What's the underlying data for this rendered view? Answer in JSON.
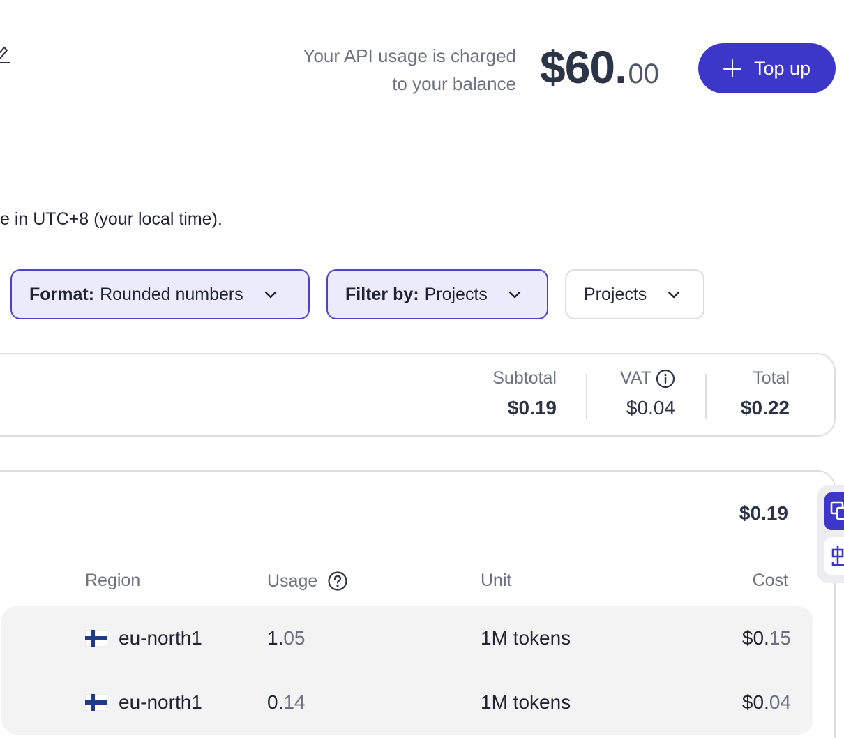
{
  "header": {
    "balance_caption_line1": "Your API usage is charged",
    "balance_caption_line2": "to your balance",
    "balance_main": "$60.",
    "balance_cents": "00",
    "topup_label": "Top up"
  },
  "timezone_note": "e in UTC+8 (your local time).",
  "filters": {
    "format_key": "Format:",
    "format_value": "Rounded numbers",
    "filter_key": "Filter by:",
    "filter_value": "Projects",
    "projects_label": "Projects"
  },
  "summary": {
    "subtotal_label": "Subtotal",
    "subtotal_value": "$0.19",
    "vat_label": "VAT",
    "vat_value": "$0.04",
    "total_label": "Total",
    "total_value": "$0.22"
  },
  "project": {
    "total": "$0.19"
  },
  "table": {
    "headers": {
      "region": "Region",
      "usage": "Usage",
      "unit": "Unit",
      "cost": "Cost"
    },
    "rows": [
      {
        "region": "eu-north1",
        "usage_int": "1.",
        "usage_dec": "05",
        "unit": "1M tokens",
        "cost_int": "$0.",
        "cost_dec": "15"
      },
      {
        "region": "eu-north1",
        "usage_int": "0.",
        "usage_dec": "14",
        "unit": "1M tokens",
        "cost_int": "$0.",
        "cost_dec": "04"
      }
    ]
  },
  "colors": {
    "accent": "#3d37c9",
    "accent_light": "#ecebfb",
    "text_primary": "#1f2433",
    "text_muted": "#6b7180",
    "border": "#dcdde1",
    "row_bg": "#f3f3f4"
  },
  "icons": [
    "edit-icon",
    "plus-icon",
    "chevron-down-icon",
    "info-icon",
    "help-icon",
    "finland-flag-icon",
    "translate-icon",
    "chinese-translate-icon"
  ]
}
